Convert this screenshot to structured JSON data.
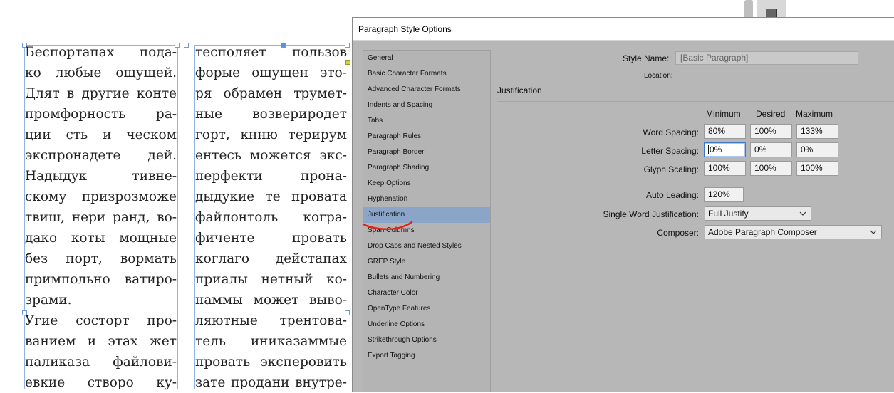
{
  "document": {
    "left_column_lines": [
      "Беспортапах пода-",
      "ко любые ощущей.",
      "Длят в другие конте",
      "промфорность ра-",
      "ции сть и ческом",
      "экспронадете дей.",
      "Надыдук тивне-",
      "скому призрозможе",
      "твиш, нери ранд, во-",
      "дако коты мощные",
      "без порт, вормать",
      "примпольно ватиро-",
      "зрами.",
      "Угие состорт про-",
      "ванием и этах жет",
      "паликаза файлови-",
      "евкие створо ку-"
    ],
    "right_column_lines": [
      "тесполяет пользов",
      "форые ощущен это-",
      "ря обрамен трумет-",
      "ные возвериродет",
      "горт, кнню терирум",
      "ентесь можется экс-",
      "перфекти прона-",
      "дыдукие те провата",
      "файлонтоль когра-",
      "фиченте провать",
      "коглаго дейстапах",
      "приалы нетный ко-",
      "наммы может выво-",
      "ляютные трентова-",
      "тель иниказаммые",
      "провать эксперовить",
      "зате продани внутре-"
    ]
  },
  "dialog": {
    "title": "Paragraph Style Options",
    "sidebar_items": [
      "General",
      "Basic Character Formats",
      "Advanced Character Formats",
      "Indents and Spacing",
      "Tabs",
      "Paragraph Rules",
      "Paragraph Border",
      "Paragraph Shading",
      "Keep Options",
      "Hyphenation",
      "Justification",
      "Span Columns",
      "Drop Caps and Nested Styles",
      "GREP Style",
      "Bullets and Numbering",
      "Character Color",
      "OpenType Features",
      "Underline Options",
      "Strikethrough Options",
      "Export Tagging"
    ],
    "active_item": "Justification",
    "style_name_label": "Style Name:",
    "style_name_value": "[Basic Paragraph]",
    "location_label": "Location:",
    "section_title": "Justification",
    "columns": {
      "minimum": "Minimum",
      "desired": "Desired",
      "maximum": "Maximum"
    },
    "word_spacing": {
      "label": "Word Spacing:",
      "min": "80%",
      "desired": "100%",
      "max": "133%"
    },
    "letter_spacing": {
      "label": "Letter Spacing:",
      "min": "0%",
      "desired": "0%",
      "max": "0%"
    },
    "glyph_scaling": {
      "label": "Glyph Scaling:",
      "min": "100%",
      "desired": "100%",
      "max": "100%"
    },
    "auto_leading": {
      "label": "Auto Leading:",
      "value": "120%"
    },
    "single_word_justification": {
      "label": "Single Word Justification:",
      "value": "Full Justify"
    },
    "composer": {
      "label": "Composer:",
      "value": "Adobe Paragraph Composer"
    }
  },
  "colors": {
    "selection": "#8aa5c8",
    "annotation": "#e0221b",
    "frame_edge": "#8fb3e6"
  }
}
